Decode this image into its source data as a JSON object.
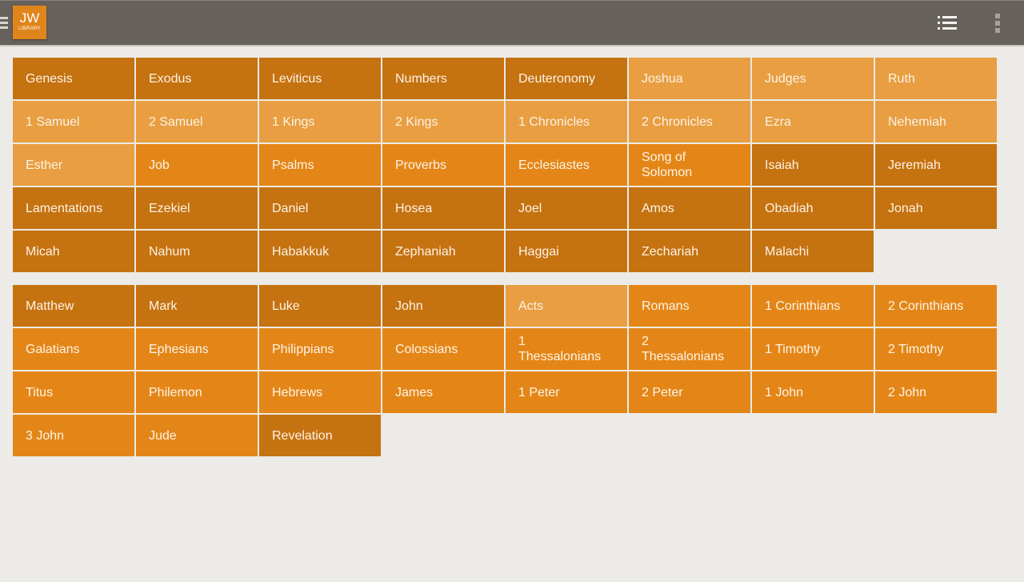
{
  "header": {
    "logo_line1": "JW",
    "logo_line2": "LIBRARY",
    "drawer_icon": "hamburger-icon",
    "view_icon": "list-view-icon",
    "overflow_icon": "overflow-menu-icon"
  },
  "colors": {
    "dark": "#c57210",
    "mid": "#e48617",
    "light": "#e89e41",
    "actionbar": "#67615b",
    "background": "#ecebe7"
  },
  "hebrew_scriptures": [
    {
      "name": "Genesis",
      "shade": "dark"
    },
    {
      "name": "Exodus",
      "shade": "dark"
    },
    {
      "name": "Leviticus",
      "shade": "dark"
    },
    {
      "name": "Numbers",
      "shade": "dark"
    },
    {
      "name": "Deuteronomy",
      "shade": "dark"
    },
    {
      "name": "Joshua",
      "shade": "light"
    },
    {
      "name": "Judges",
      "shade": "light"
    },
    {
      "name": "Ruth",
      "shade": "light"
    },
    {
      "name": "1 Samuel",
      "shade": "light"
    },
    {
      "name": "2 Samuel",
      "shade": "light"
    },
    {
      "name": "1 Kings",
      "shade": "light"
    },
    {
      "name": "2 Kings",
      "shade": "light"
    },
    {
      "name": "1 Chronicles",
      "shade": "light"
    },
    {
      "name": "2 Chronicles",
      "shade": "light"
    },
    {
      "name": "Ezra",
      "shade": "light"
    },
    {
      "name": "Nehemiah",
      "shade": "light"
    },
    {
      "name": "Esther",
      "shade": "light"
    },
    {
      "name": "Job",
      "shade": "mid"
    },
    {
      "name": "Psalms",
      "shade": "mid"
    },
    {
      "name": "Proverbs",
      "shade": "mid"
    },
    {
      "name": "Ecclesiastes",
      "shade": "mid"
    },
    {
      "name": "Song of Solomon",
      "shade": "mid"
    },
    {
      "name": "Isaiah",
      "shade": "dark"
    },
    {
      "name": "Jeremiah",
      "shade": "dark"
    },
    {
      "name": "Lamentations",
      "shade": "dark"
    },
    {
      "name": "Ezekiel",
      "shade": "dark"
    },
    {
      "name": "Daniel",
      "shade": "dark"
    },
    {
      "name": "Hosea",
      "shade": "dark"
    },
    {
      "name": "Joel",
      "shade": "dark"
    },
    {
      "name": "Amos",
      "shade": "dark"
    },
    {
      "name": "Obadiah",
      "shade": "dark"
    },
    {
      "name": "Jonah",
      "shade": "dark"
    },
    {
      "name": "Micah",
      "shade": "dark"
    },
    {
      "name": "Nahum",
      "shade": "dark"
    },
    {
      "name": "Habakkuk",
      "shade": "dark"
    },
    {
      "name": "Zephaniah",
      "shade": "dark"
    },
    {
      "name": "Haggai",
      "shade": "dark"
    },
    {
      "name": "Zechariah",
      "shade": "dark"
    },
    {
      "name": "Malachi",
      "shade": "dark"
    }
  ],
  "greek_scriptures": [
    {
      "name": "Matthew",
      "shade": "dark"
    },
    {
      "name": "Mark",
      "shade": "dark"
    },
    {
      "name": "Luke",
      "shade": "dark"
    },
    {
      "name": "John",
      "shade": "dark"
    },
    {
      "name": "Acts",
      "shade": "light"
    },
    {
      "name": "Romans",
      "shade": "mid"
    },
    {
      "name": "1 Corinthians",
      "shade": "mid"
    },
    {
      "name": "2 Corinthians",
      "shade": "mid"
    },
    {
      "name": "Galatians",
      "shade": "mid"
    },
    {
      "name": "Ephesians",
      "shade": "mid"
    },
    {
      "name": "Philippians",
      "shade": "mid"
    },
    {
      "name": "Colossians",
      "shade": "mid"
    },
    {
      "name": "1 Thessalonians",
      "shade": "mid"
    },
    {
      "name": "2 Thessalonians",
      "shade": "mid"
    },
    {
      "name": "1 Timothy",
      "shade": "mid"
    },
    {
      "name": "2 Timothy",
      "shade": "mid"
    },
    {
      "name": "Titus",
      "shade": "mid"
    },
    {
      "name": "Philemon",
      "shade": "mid"
    },
    {
      "name": "Hebrews",
      "shade": "mid"
    },
    {
      "name": "James",
      "shade": "mid"
    },
    {
      "name": "1 Peter",
      "shade": "mid"
    },
    {
      "name": "2 Peter",
      "shade": "mid"
    },
    {
      "name": "1 John",
      "shade": "mid"
    },
    {
      "name": "2 John",
      "shade": "mid"
    },
    {
      "name": "3 John",
      "shade": "mid"
    },
    {
      "name": "Jude",
      "shade": "mid"
    },
    {
      "name": "Revelation",
      "shade": "dark"
    }
  ]
}
